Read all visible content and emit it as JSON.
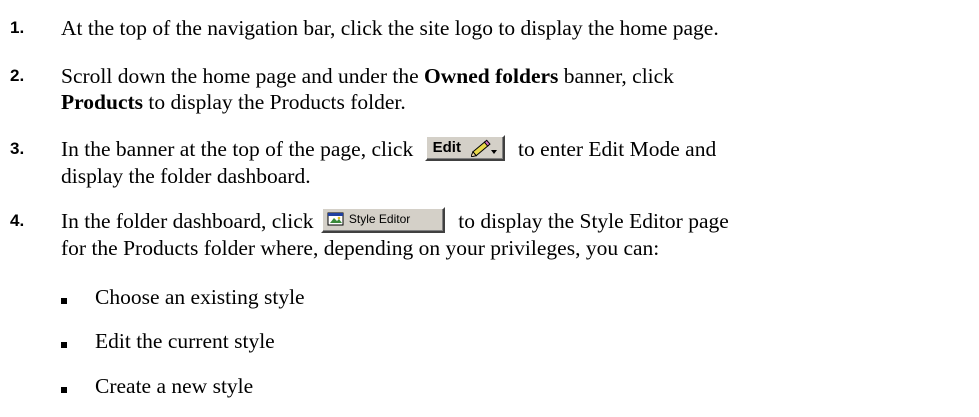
{
  "steps": [
    {
      "number": "1.",
      "line1": "At the top of the navigation bar, click the site logo to display the home page."
    },
    {
      "number": "2.",
      "line1_pre": "Scroll down the home page and under the ",
      "line1_bold": "Owned folders",
      "line1_post": " banner, click",
      "line2_bold": "Products",
      "line2_post": " to display the Products folder."
    },
    {
      "number": "3.",
      "line1_pre": "In the banner at the top of the page, click",
      "button_label": "Edit",
      "button_icon": "pencil-dropdown-icon",
      "line1_post": "to enter Edit Mode and",
      "line2": "display the folder dashboard."
    },
    {
      "number": "4.",
      "line1_pre": "In the folder dashboard, click",
      "button_label": "Style Editor",
      "button_icon": "style-editor-icon",
      "line1_post": "to display the Style Editor page",
      "line2": "for the Products folder where, depending on your privileges, you can:"
    }
  ],
  "options": [
    "Choose an existing style",
    "Edit the current style",
    "Create a new style"
  ]
}
